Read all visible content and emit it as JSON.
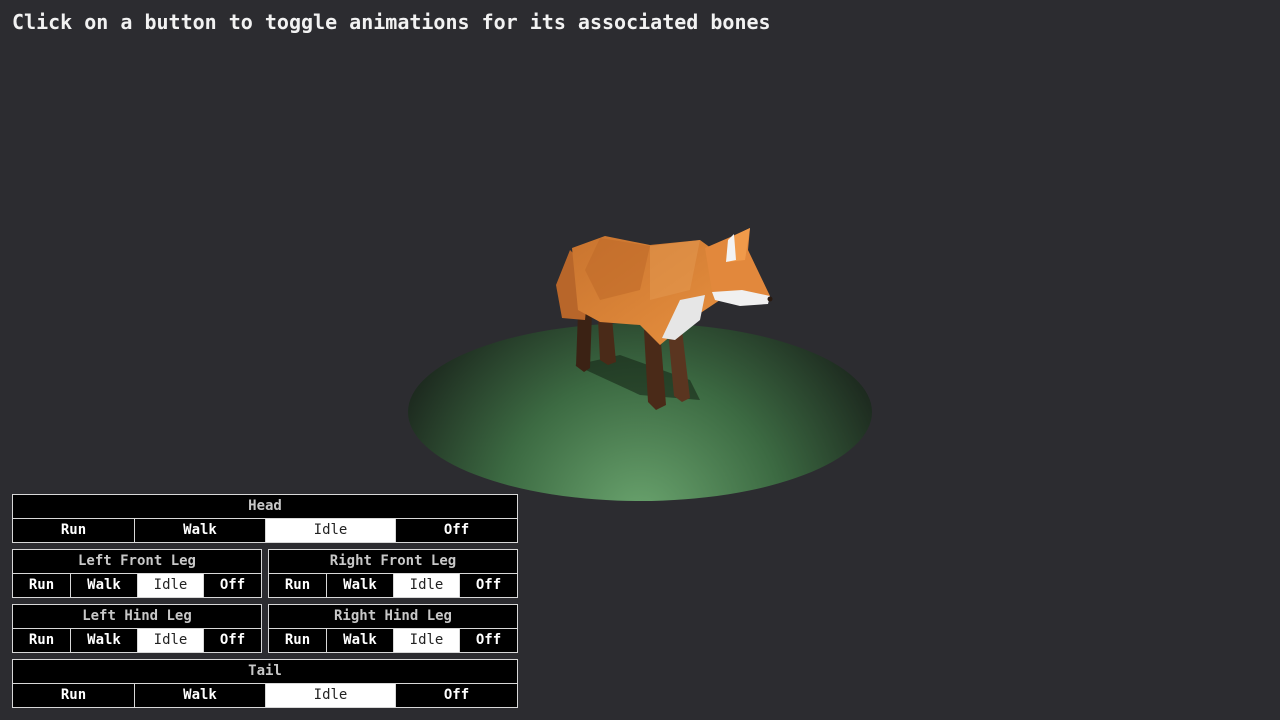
{
  "instruction": "Click on a button to toggle animations for its associated bones",
  "panels": [
    {
      "title": "Head",
      "buttons": [
        "Run",
        "Walk",
        "Idle",
        "Off"
      ],
      "active": "Idle"
    },
    {
      "title": "Left Front Leg",
      "buttons": [
        "Run",
        "Walk",
        "Idle",
        "Off"
      ],
      "active": "Idle"
    },
    {
      "title": "Right Front Leg",
      "buttons": [
        "Run",
        "Walk",
        "Idle",
        "Off"
      ],
      "active": "Idle"
    },
    {
      "title": "Left Hind Leg",
      "buttons": [
        "Run",
        "Walk",
        "Idle",
        "Off"
      ],
      "active": "Idle"
    },
    {
      "title": "Right Hind Leg",
      "buttons": [
        "Run",
        "Walk",
        "Idle",
        "Off"
      ],
      "active": "Idle"
    },
    {
      "title": "Tail",
      "buttons": [
        "Run",
        "Walk",
        "Idle",
        "Off"
      ],
      "active": "Idle"
    }
  ],
  "colors": {
    "background": "#2c2c30",
    "ground_dark": "#1e2a1e",
    "ground_light": "#6aa36e",
    "fox_orange": "#d9823a",
    "fox_white": "#e8e8e8",
    "fox_legs": "#4a2a18"
  }
}
